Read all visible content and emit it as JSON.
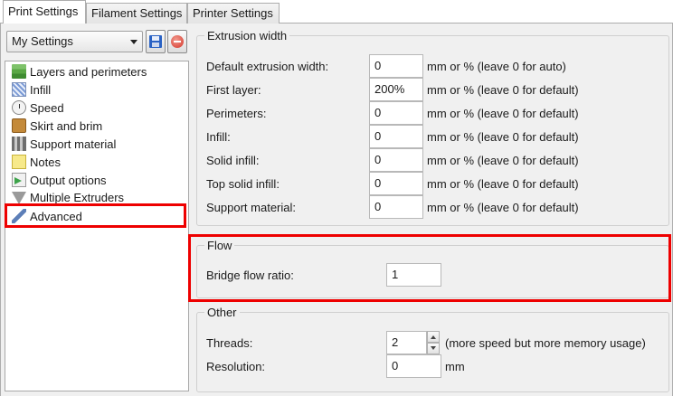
{
  "tabs": [
    {
      "label": "Print Settings"
    },
    {
      "label": "Filament Settings"
    },
    {
      "label": "Printer Settings"
    }
  ],
  "preset": {
    "selected": "My Settings"
  },
  "tree": {
    "items": [
      {
        "label": "Layers and perimeters",
        "icon": "layers-icon"
      },
      {
        "label": "Infill",
        "icon": "infill-icon"
      },
      {
        "label": "Speed",
        "icon": "speed-icon"
      },
      {
        "label": "Skirt and brim",
        "icon": "skirt-icon"
      },
      {
        "label": "Support material",
        "icon": "support-icon"
      },
      {
        "label": "Notes",
        "icon": "notes-icon"
      },
      {
        "label": "Output options",
        "icon": "output-icon"
      },
      {
        "label": "Multiple Extruders",
        "icon": "extruders-icon"
      },
      {
        "label": "Advanced",
        "icon": "wrench-icon"
      }
    ],
    "selected": "Advanced"
  },
  "extrusion_width": {
    "title": "Extrusion width",
    "rows": [
      {
        "label": "Default extrusion width:",
        "value": "0",
        "unit": "mm or % (leave 0 for auto)"
      },
      {
        "label": "First layer:",
        "value": "200%",
        "unit": "mm or % (leave 0 for default)"
      },
      {
        "label": "Perimeters:",
        "value": "0",
        "unit": "mm or % (leave 0 for default)"
      },
      {
        "label": "Infill:",
        "value": "0",
        "unit": "mm or % (leave 0 for default)"
      },
      {
        "label": "Solid infill:",
        "value": "0",
        "unit": "mm or % (leave 0 for default)"
      },
      {
        "label": "Top solid infill:",
        "value": "0",
        "unit": "mm or % (leave 0 for default)"
      },
      {
        "label": "Support material:",
        "value": "0",
        "unit": "mm or % (leave 0 for default)"
      }
    ]
  },
  "flow": {
    "title": "Flow",
    "bridge_label": "Bridge flow ratio:",
    "bridge_value": "1"
  },
  "other": {
    "title": "Other",
    "threads_label": "Threads:",
    "threads_value": "2",
    "threads_note": "(more speed but more memory usage)",
    "resolution_label": "Resolution:",
    "resolution_value": "0",
    "resolution_unit": "mm"
  },
  "highlight_color": "#ee0000"
}
